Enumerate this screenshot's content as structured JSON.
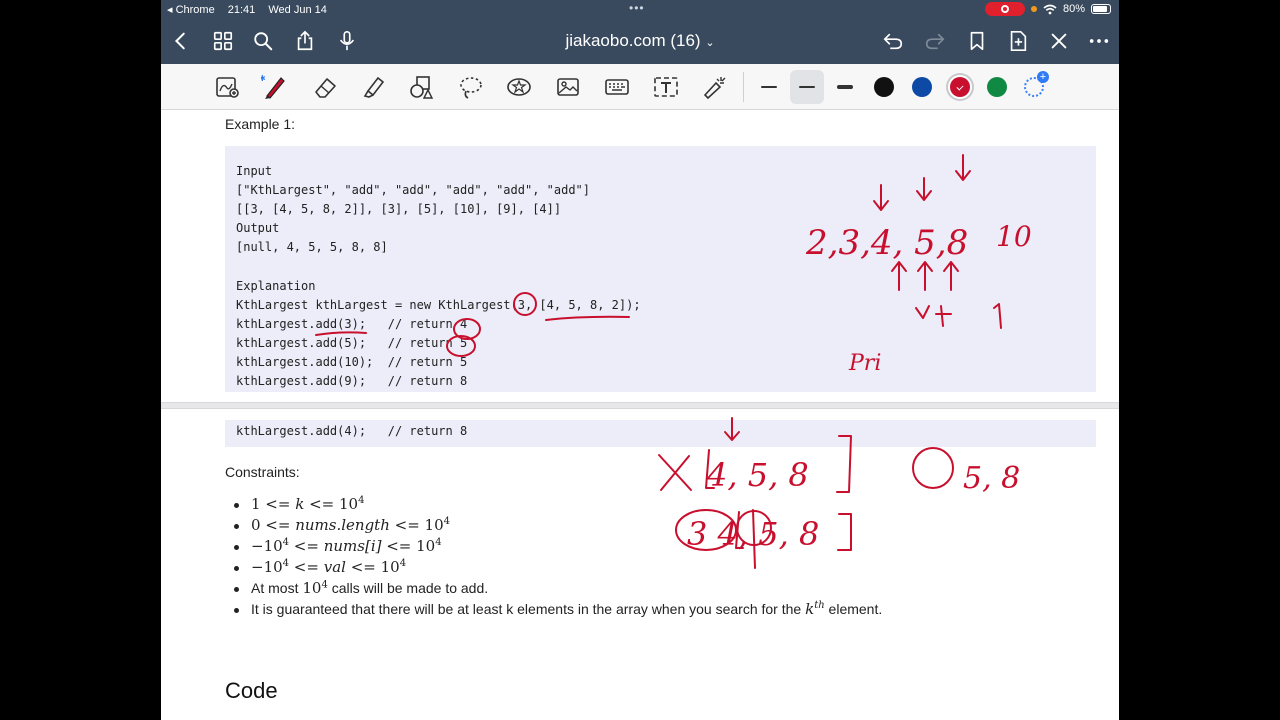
{
  "status": {
    "back_app": "Chrome",
    "time": "21:41",
    "date": "Wed Jun 14",
    "battery": "80%"
  },
  "nav": {
    "title": "jiakaobo.com (16)"
  },
  "toolbar": {
    "tools": [
      "lasso-zoom",
      "pen",
      "eraser",
      "highlighter",
      "shapes",
      "lasso",
      "sticker",
      "image",
      "keyboard",
      "text",
      "laser-pointer"
    ],
    "colors": [
      "#111111",
      "#0d4aa5",
      "#c8102e",
      "#108a43"
    ],
    "selected_color": "#c8102e"
  },
  "doc": {
    "example_heading": "Example 1:",
    "code_lines": [
      "Input",
      "[\"KthLargest\", \"add\", \"add\", \"add\", \"add\", \"add\"]",
      "[[3, [4, 5, 8, 2]], [3], [5], [10], [9], [4]]",
      "Output",
      "[null, 4, 5, 5, 8, 8]",
      "",
      "Explanation",
      "KthLargest kthLargest = new KthLargest(3, [4, 5, 8, 2]);",
      "kthLargest.add(3);   // return 4",
      "kthLargest.add(5);   // return 5",
      "kthLargest.add(10);  // return 5",
      "kthLargest.add(9);   // return 8"
    ],
    "code_continued": "kthLargest.add(4);   // return 8",
    "constraints_heading": "Constraints:",
    "constraints": {
      "c1": {
        "a": "1 <= ",
        "v": "k",
        "b": " <= 10",
        "e": "4"
      },
      "c2": {
        "a": "0 <= ",
        "v": "nums.length",
        "b": " <= 10",
        "e": "4"
      },
      "c3": {
        "a": "−10",
        "e1": "4",
        "m": " <= ",
        "v": "nums[i]",
        "b": " <= 10",
        "e2": "4"
      },
      "c4": {
        "a": "−10",
        "e1": "4",
        "m": " <= ",
        "v": "val",
        "b": " <= 10",
        "e2": "4"
      },
      "c5": {
        "pre": "At most ",
        "base": "10",
        "e": "4",
        "post": " calls will be made to add."
      },
      "c6": {
        "pre": "It is guaranteed that there will be at least k elements in the array when you search for the ",
        "v": "k",
        "e": "th",
        "post": " element."
      }
    },
    "code_heading": "Code"
  },
  "ink_notes": {
    "note1": "2,3,4, 5,8",
    "note2": "10",
    "note3": "Pri",
    "note4": "4, 5, 8",
    "note5": "5, 8",
    "note6": "3 4, 5, 8"
  }
}
